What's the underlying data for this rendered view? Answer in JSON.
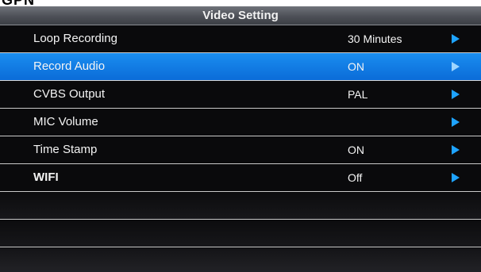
{
  "header": {
    "title": "Video Setting",
    "top_fragment": "GPN"
  },
  "menu": {
    "items": [
      {
        "label": "Loop Recording",
        "value": "30 Minutes",
        "selected": false
      },
      {
        "label": "Record Audio",
        "value": "ON",
        "selected": true
      },
      {
        "label": "CVBS Output",
        "value": "PAL",
        "selected": false
      },
      {
        "label": "MIC Volume",
        "value": "",
        "selected": false
      },
      {
        "label": "Time Stamp",
        "value": "ON",
        "selected": false
      },
      {
        "label": "WIFI",
        "value": "Off",
        "selected": false
      }
    ],
    "arrow_icon": "chevron-right-icon",
    "highlight_color": "#1a8ef0",
    "arrow_color": "#1ea3ff"
  }
}
